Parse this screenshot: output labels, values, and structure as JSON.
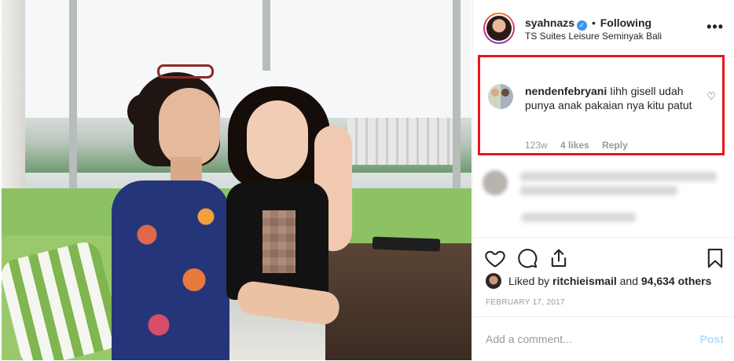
{
  "post": {
    "username": "syahnazs",
    "separator": "•",
    "follow_status": "Following",
    "location": "TS Suites Leisure Seminyak Bali",
    "more_label": "•••"
  },
  "highlighted_comment": {
    "username": "nendenfebryani",
    "text": "Iihh gisell udah punya anak pakaian nya kitu patut",
    "age": "123w",
    "likes": "4 likes",
    "reply_label": "Reply"
  },
  "likes": {
    "prefix": "Liked by",
    "liker": "ritchieismail",
    "middle": "and",
    "others": "94,634 others"
  },
  "date": "FEBRUARY 17, 2017",
  "add_comment": {
    "placeholder": "Add a comment...",
    "post_label": "Post"
  },
  "colors": {
    "verified": "#3897f0",
    "highlight_border": "#e5171e",
    "post_disabled": "#b3dbff"
  },
  "icons": [
    "heart-icon",
    "comment-icon",
    "share-icon",
    "bookmark-icon",
    "verified-badge-icon",
    "more-options-icon"
  ]
}
